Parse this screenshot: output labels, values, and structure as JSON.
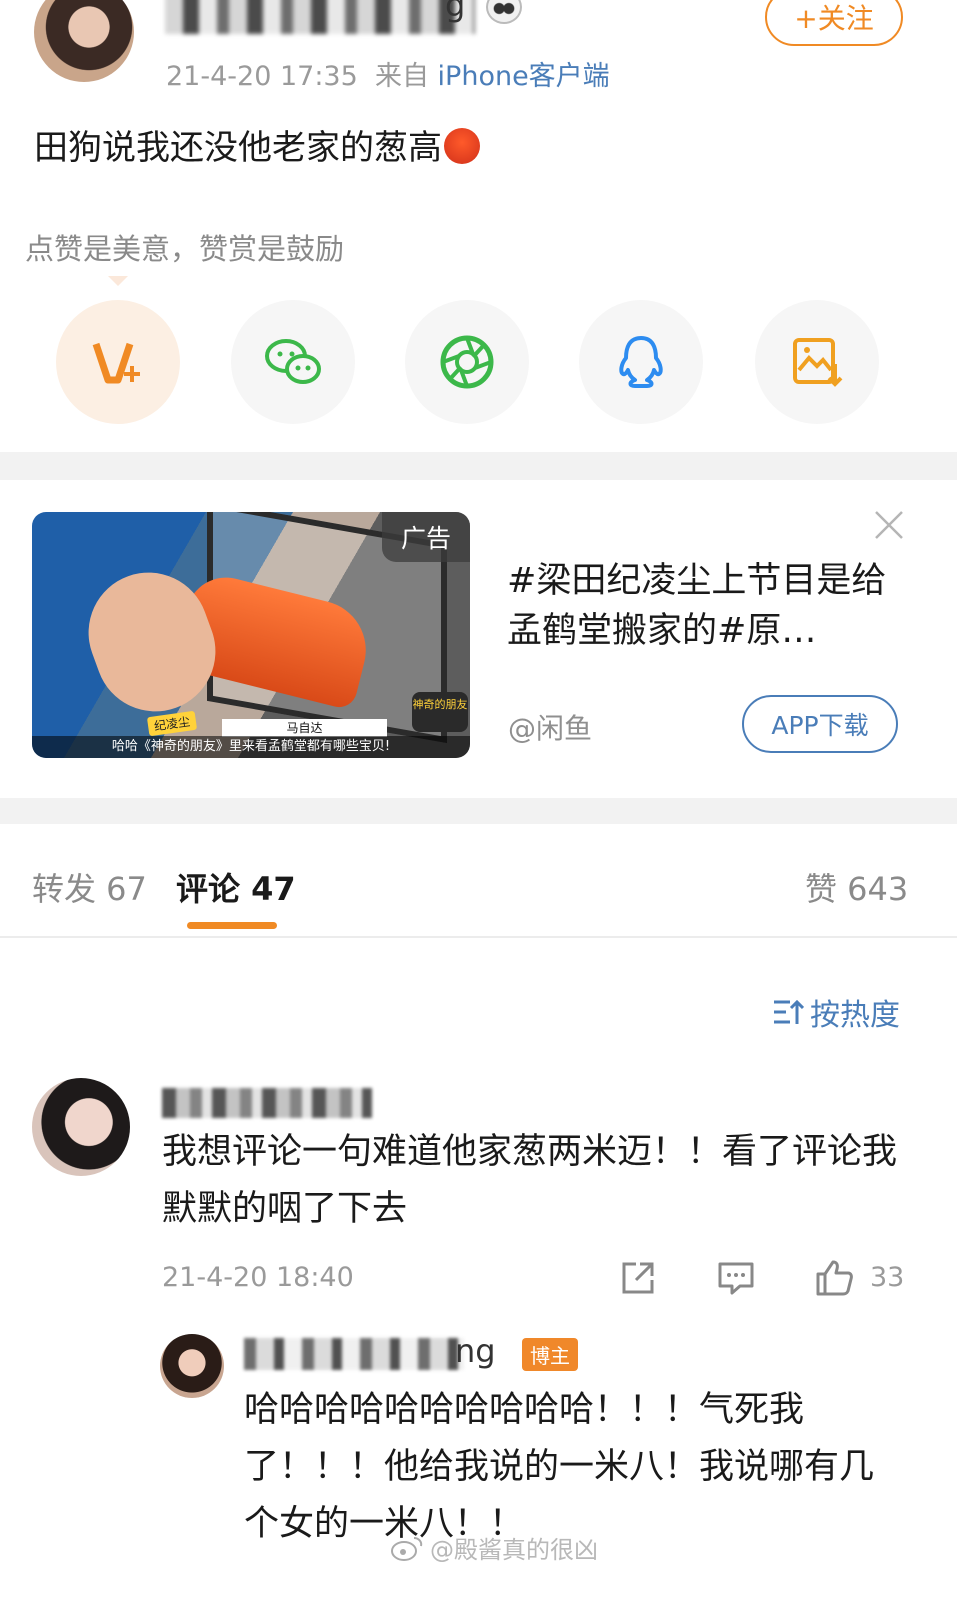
{
  "post": {
    "username_visible_tail": "g",
    "time": "21-4-20 17:35",
    "source_prefix": "来自 ",
    "source": "iPhone客户端",
    "text": "田狗说我还没他老家的葱高",
    "follow_label": "+关注"
  },
  "reward": {
    "tip": "点赞是美意，赞赏是鼓励"
  },
  "ad": {
    "badge": "广告",
    "image_tag": "纪凌尘",
    "image_name": "马自达",
    "image_caption": "哈哈《神奇的朋友》里来看孟鹤堂都有哪些宝贝!",
    "image_logo": "神奇的朋友",
    "title": "#梁田纪凌尘上节目是给孟鹤堂搬家的#原…",
    "source": "@闲鱼",
    "button": "APP下载"
  },
  "tabs": {
    "repost": "转发 67",
    "comments": "评论 47",
    "likes": "赞 643"
  },
  "sort_label": "按热度",
  "comment": {
    "text": "我想评论一句难道他家葱两米迈！！看了评论我默默的咽了下去",
    "time": "21-4-20 18:40",
    "like_count": "33"
  },
  "reply": {
    "username_visible_tail": "ng",
    "badge": "博主",
    "text": "哈哈哈哈哈哈哈哈哈哈！！！气死我了！！！他给我说的一米八！我说哪有几个女的一米八！！"
  },
  "watermark": "@殿酱真的很凶",
  "colors": {
    "accent_orange": "#f08a24",
    "link_blue": "#4a7db8",
    "gray_text": "#9a9a9a"
  },
  "icons": [
    "panda-icon",
    "vip-reward-icon",
    "wechat-icon",
    "moments-icon",
    "qq-icon",
    "save-image-icon",
    "close-icon",
    "sort-icon",
    "share-icon",
    "comment-icon",
    "like-icon",
    "weibo-logo-icon"
  ]
}
